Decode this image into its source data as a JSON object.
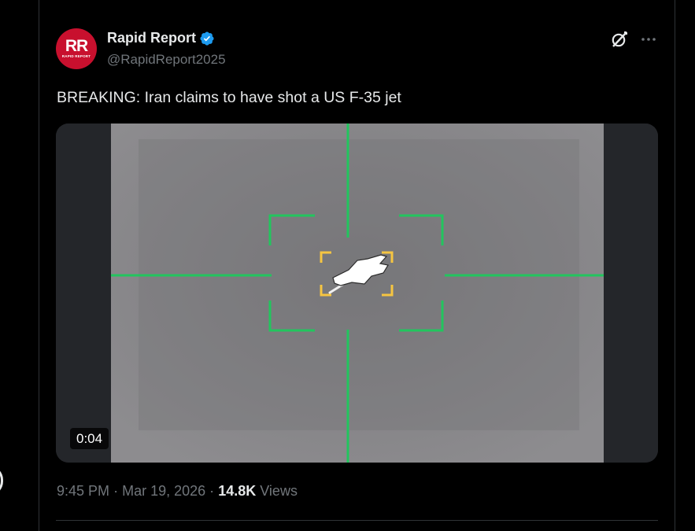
{
  "tweet": {
    "author": {
      "display_name": "Rapid Report",
      "handle": "@RapidReport2025",
      "avatar_initials": "RR",
      "avatar_subtext": "RAPID REPORT",
      "verified": true,
      "avatar_color": "#c8102e"
    },
    "text": "BREAKING: Iran claims to have shot a US F-35 jet",
    "media": {
      "type": "video",
      "duration": "0:04",
      "reticle_color": "#22c55e",
      "target_box_color": "#f5c542"
    },
    "meta": {
      "time": "9:45 PM",
      "separator": "·",
      "date": "Mar 19, 2026",
      "views_count": "14.8K",
      "views_label": "Views"
    }
  },
  "icons": {
    "grok": "grok-icon",
    "more": "more-icon",
    "verified": "verified-badge-icon"
  },
  "colors": {
    "background": "#000000",
    "text_primary": "#e7e9ea",
    "text_secondary": "#71767b",
    "border": "#2f3336",
    "verified_blue": "#1d9bf0"
  }
}
